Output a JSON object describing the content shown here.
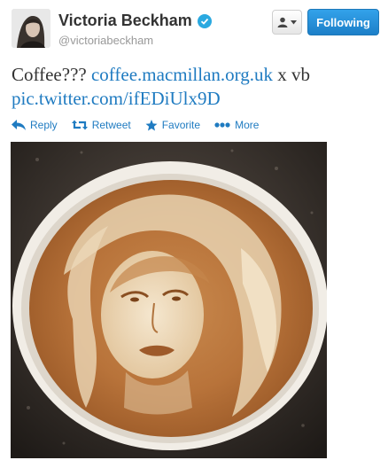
{
  "user": {
    "display_name": "Victoria Beckham",
    "handle": "@victoriabeckham",
    "verified_icon": "verified-badge-icon"
  },
  "buttons": {
    "user_actions_icon": "person-icon",
    "follow_label": "Following"
  },
  "tweet": {
    "text_plain": "Coffee??? ",
    "link1": "coffee.macmillan.org.uk",
    "text_after": " x vb",
    "link2": "pic.twitter.com/ifEDiUlx9D"
  },
  "actions": {
    "reply_label": "Reply",
    "retweet_label": "Retweet",
    "favorite_label": "Favorite",
    "more_label": "More"
  },
  "colors": {
    "link": "#1f7bc1",
    "follow_bg": "#2a8fd8",
    "verified": "#2aa9e0"
  }
}
